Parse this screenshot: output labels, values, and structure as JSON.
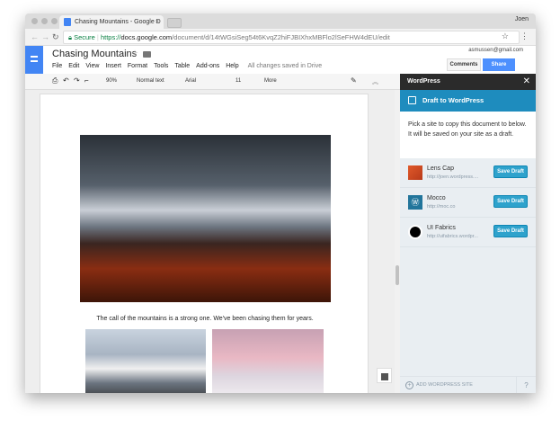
{
  "browser": {
    "tab_title": "Chasing Mountains - Google D",
    "user": "Joen",
    "secure_label": "Secure",
    "url_scheme": "https://",
    "url_host": "docs.google.com",
    "url_path": "/document/d/14tWGsiSeg54t6KvqZ2hiFJBIXhxMBFlo2lSeFHW4dEU/edit"
  },
  "doc": {
    "title": "Chasing Mountains",
    "menus": [
      "File",
      "Edit",
      "View",
      "Insert",
      "Format",
      "Tools",
      "Table",
      "Add-ons",
      "Help"
    ],
    "save_status": "All changes saved in Drive",
    "email": "asmussen@gmail.com",
    "comments_label": "Comments",
    "share_label": "Share",
    "toolbar": {
      "zoom": "90%",
      "style": "Normal text",
      "font": "Arial",
      "size": "11",
      "more": "More"
    },
    "caption": "The call of the mountains is a strong one. We've been chasing them for years."
  },
  "panel": {
    "title": "WordPress",
    "banner": "Draft to WordPress",
    "description": "Pick a site to copy this document to below. It will be saved on your site as a draft.",
    "sites": [
      {
        "name": "Lens Cap",
        "url": "http://joen.wordpress....",
        "button": "Save Draft"
      },
      {
        "name": "Mocco",
        "url": "http://moc.co",
        "button": "Save Draft"
      },
      {
        "name": "UI Fabrics",
        "url": "http://uifabrics.wordpr...",
        "button": "Save Draft"
      }
    ],
    "add_site": "ADD WORDPRESS SITE"
  },
  "colors": {
    "wp_blue": "#1e8cbe",
    "button_blue": "#2ea2cc",
    "share_blue": "#4d90fe",
    "docs_blue": "#4285f4"
  }
}
